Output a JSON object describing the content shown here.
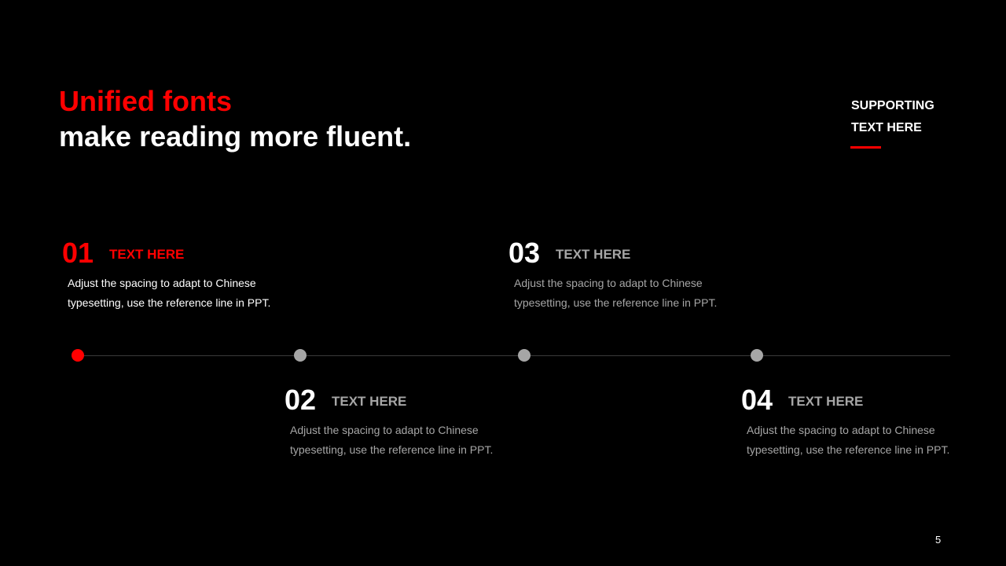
{
  "slide": {
    "title_highlight": "Unified fonts",
    "title_rest": "make reading more fluent.",
    "supporting_text": [
      "SUPPORTING",
      "TEXT HERE"
    ],
    "page_number": "5"
  },
  "colors": {
    "accent": "#ff0000",
    "inactive_dot": "#a6a6a6",
    "muted_text": "#a6a6a6",
    "background": "#000000",
    "timeline_line": "#3a3a3a"
  },
  "steps": [
    {
      "number": "01",
      "label": "TEXT HERE",
      "description": [
        "Adjust the spacing to adapt to Chinese",
        "typesetting, use the reference line in PPT."
      ],
      "active": true
    },
    {
      "number": "02",
      "label": "TEXT HERE",
      "description": [
        "Adjust the spacing to adapt to Chinese",
        "typesetting, use the reference line in PPT."
      ],
      "active": false
    },
    {
      "number": "03",
      "label": "TEXT HERE",
      "description": [
        "Adjust the spacing to adapt to Chinese",
        "typesetting, use the reference line in PPT."
      ],
      "active": false
    },
    {
      "number": "04",
      "label": "TEXT HERE",
      "description": [
        "Adjust the spacing to adapt to Chinese",
        "typesetting, use the reference line in PPT."
      ],
      "active": false
    }
  ]
}
